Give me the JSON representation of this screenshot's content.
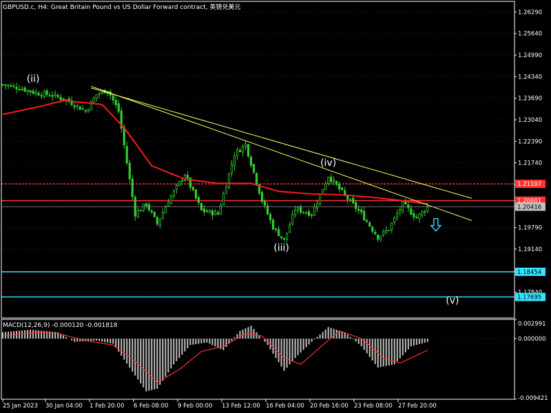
{
  "header": {
    "title": "GBPUSD.c, H4:  Great Britain Pound vs US Dollar Forward contract, 英镑兑美元"
  },
  "macd": {
    "label": "MACD(12,26,9) -0.000120 -0.001818"
  },
  "colors": {
    "background": "#000000",
    "candle": "#32cd32",
    "ma_line": "#ff1a1a",
    "trend_line": "#ffff66",
    "resistance": "#ff3333",
    "support": "#33e6ff",
    "macd_hist": "#c0c0c0",
    "macd_signal": "#ff3030",
    "current_price_badge": "#c0c0c0",
    "arrow": "#33ccff"
  },
  "chart_data": [
    {
      "type": "candlestick",
      "title": "GBPUSD.c, H4",
      "ylim": [
        1.1706,
        1.2661
      ],
      "y_ticks": [
        "1.26290",
        "1.25640",
        "1.24990",
        "1.24340",
        "1.23690",
        "1.23040",
        "1.22390",
        "1.21740",
        "1.21090",
        "1.20440",
        "1.19790",
        "1.19140",
        "1.18490",
        "1.17840"
      ],
      "x_ticks": [
        "25 Jan 2023",
        "30 Jan 04:00",
        "1 Feb 20:00",
        "6 Feb 08:00",
        "9 Feb 00:00",
        "13 Feb 12:00",
        "16 Feb 04:00",
        "20 Feb 16:00",
        "23 Feb 08:00",
        "27 Feb 20:00"
      ],
      "close_path": [
        [
          0,
          1.241
        ],
        [
          6,
          1.24
        ],
        [
          12,
          1.2385
        ],
        [
          18,
          1.2378
        ],
        [
          24,
          1.236
        ],
        [
          30,
          1.233
        ],
        [
          34,
          1.238
        ],
        [
          38,
          1.2395
        ],
        [
          42,
          1.233
        ],
        [
          48,
          1.202
        ],
        [
          52,
          1.205
        ],
        [
          56,
          1.199
        ],
        [
          60,
          1.206
        ],
        [
          66,
          1.214
        ],
        [
          72,
          1.203
        ],
        [
          78,
          1.202
        ],
        [
          84,
          1.22
        ],
        [
          88,
          1.223
        ],
        [
          94,
          1.206
        ],
        [
          98,
          1.198
        ],
        [
          102,
          1.194
        ],
        [
          106,
          1.2035
        ],
        [
          112,
          1.202
        ],
        [
          118,
          1.2135
        ],
        [
          124,
          1.2075
        ],
        [
          130,
          1.202
        ],
        [
          136,
          1.195
        ],
        [
          140,
          1.1975
        ],
        [
          145,
          1.205
        ],
        [
          150,
          1.2008
        ],
        [
          154,
          1.2042
        ]
      ],
      "ma_path": [
        [
          0,
          1.232
        ],
        [
          14,
          1.2345
        ],
        [
          22,
          1.2362
        ],
        [
          36,
          1.235
        ],
        [
          44,
          1.228
        ],
        [
          54,
          1.2165
        ],
        [
          66,
          1.2125
        ],
        [
          78,
          1.2112
        ],
        [
          90,
          1.2112
        ],
        [
          100,
          1.2088
        ],
        [
          112,
          1.208
        ],
        [
          122,
          1.2078
        ],
        [
          134,
          1.207
        ],
        [
          145,
          1.206
        ],
        [
          154,
          1.205
        ]
      ],
      "trend_lines": [
        {
          "from": [
            32,
            1.24
          ],
          "to": [
            170,
            1.2067
          ]
        },
        {
          "from": [
            32,
            1.2405
          ],
          "to": [
            170,
            1.2
          ]
        }
      ],
      "horizontal_levels": [
        {
          "price": 1.21107,
          "label": "1.21107",
          "color": "#ff3333",
          "style": "dashed"
        },
        {
          "price": 1.20601,
          "label": "1.20601",
          "color": "#ff3333",
          "style": "solid"
        },
        {
          "price": 1.18454,
          "label": "1.18454",
          "color": "#33e6ff",
          "style": "solid"
        },
        {
          "price": 1.17695,
          "label": "1.17695",
          "color": "#33e6ff",
          "style": "solid"
        }
      ],
      "current_price": {
        "value": 1.20416,
        "label": "1.20416"
      },
      "wave_labels": [
        {
          "text": "(ii)",
          "bar": 11,
          "price": 1.2418
        },
        {
          "text": "(iii)",
          "bar": 101,
          "price": 1.1908
        },
        {
          "text": "(iv)",
          "bar": 118,
          "price": 1.2165
        },
        {
          "text": "(v)",
          "bar": 163,
          "price": 1.175
        }
      ],
      "arrow": {
        "bar": 157,
        "price": 1.1985,
        "direction": "down"
      }
    },
    {
      "type": "bar",
      "title": "MACD(12,26,9) -0.000120 -0.001818",
      "ylim": [
        -0.009421,
        0.002991
      ],
      "y_ticks": [
        "0.002991",
        "0.000000",
        "-0.009421"
      ],
      "hist_path": [
        [
          0,
          0.001
        ],
        [
          10,
          0.0014
        ],
        [
          20,
          0.001
        ],
        [
          26,
          -0.0005
        ],
        [
          34,
          -0.0003
        ],
        [
          40,
          -0.0008
        ],
        [
          46,
          -0.0045
        ],
        [
          52,
          -0.0082
        ],
        [
          56,
          -0.0078
        ],
        [
          62,
          -0.004
        ],
        [
          68,
          -0.001
        ],
        [
          74,
          -0.0006
        ],
        [
          80,
          -0.0018
        ],
        [
          86,
          0.0012
        ],
        [
          90,
          0.002
        ],
        [
          96,
          -0.001
        ],
        [
          102,
          -0.005
        ],
        [
          106,
          -0.003
        ],
        [
          112,
          -0.0005
        ],
        [
          118,
          0.0018
        ],
        [
          124,
          0.001
        ],
        [
          130,
          -0.0012
        ],
        [
          136,
          -0.0045
        ],
        [
          142,
          -0.004
        ],
        [
          148,
          -0.0012
        ],
        [
          154,
          -0.0005
        ]
      ],
      "signal_path": [
        [
          0,
          0.0004
        ],
        [
          12,
          0.001
        ],
        [
          20,
          0.0008
        ],
        [
          30,
          -0.0003
        ],
        [
          40,
          -0.001
        ],
        [
          48,
          -0.0035
        ],
        [
          56,
          -0.0068
        ],
        [
          64,
          -0.0048
        ],
        [
          72,
          -0.002
        ],
        [
          80,
          -0.0012
        ],
        [
          88,
          0.0008
        ],
        [
          94,
          0.0004
        ],
        [
          102,
          -0.003
        ],
        [
          108,
          -0.004
        ],
        [
          116,
          -0.001
        ],
        [
          122,
          0.0012
        ],
        [
          130,
          0.0
        ],
        [
          138,
          -0.003
        ],
        [
          144,
          -0.0038
        ],
        [
          154,
          -0.0018
        ]
      ]
    }
  ]
}
